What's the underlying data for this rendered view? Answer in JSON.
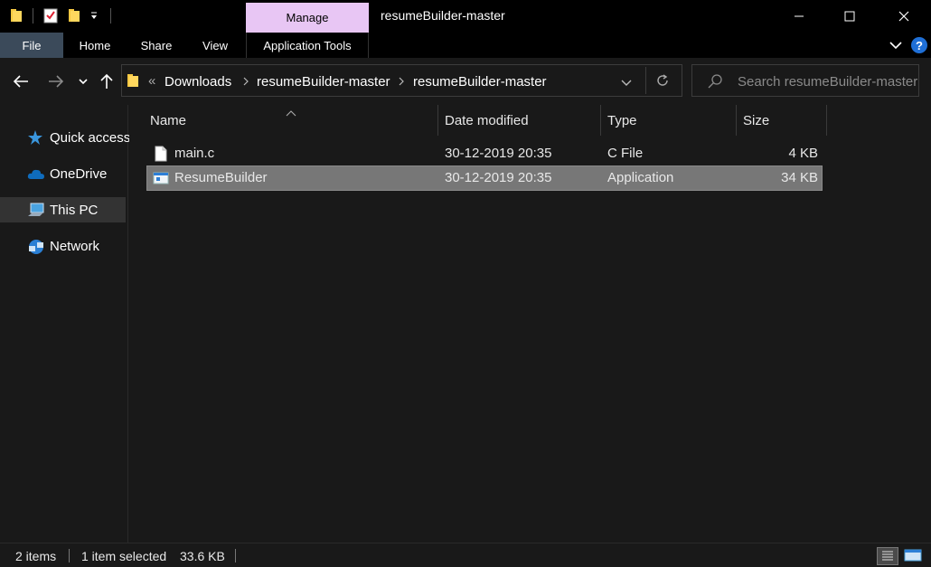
{
  "titlebar": {
    "contextual_tab": "Manage",
    "window_title": "resumeBuilder-master"
  },
  "ribbon": {
    "tabs": [
      "File",
      "Home",
      "Share",
      "View",
      "Application Tools"
    ]
  },
  "address": {
    "overflow_glyph": "«",
    "breadcrumbs": [
      "Downloads",
      "resumeBuilder-master",
      "resumeBuilder-master"
    ]
  },
  "search": {
    "placeholder": "Search resumeBuilder-master"
  },
  "navpane": {
    "items": [
      {
        "label": "Quick access",
        "icon": "star-icon"
      },
      {
        "label": "OneDrive",
        "icon": "cloud-icon"
      },
      {
        "label": "This PC",
        "icon": "computer-icon",
        "selected": true
      },
      {
        "label": "Network",
        "icon": "network-icon"
      }
    ]
  },
  "filelist": {
    "columns": [
      "Name",
      "Date modified",
      "Type",
      "Size"
    ],
    "rows": [
      {
        "name": "main.c",
        "date": "30-12-2019 20:35",
        "type": "C File",
        "size": "4 KB",
        "icon": "file-icon"
      },
      {
        "name": "ResumeBuilder",
        "date": "30-12-2019 20:35",
        "type": "Application",
        "size": "34 KB",
        "icon": "application-icon",
        "selected": true
      }
    ]
  },
  "status": {
    "item_count": "2 items",
    "selection": "1 item selected",
    "selection_size": "33.6 KB"
  },
  "colors": {
    "background": "#191919",
    "manage_tab": "#e8c6f4",
    "file_tab": "#3b4a5a",
    "selected_row": "#777777",
    "accent_blue": "#0078d7"
  }
}
